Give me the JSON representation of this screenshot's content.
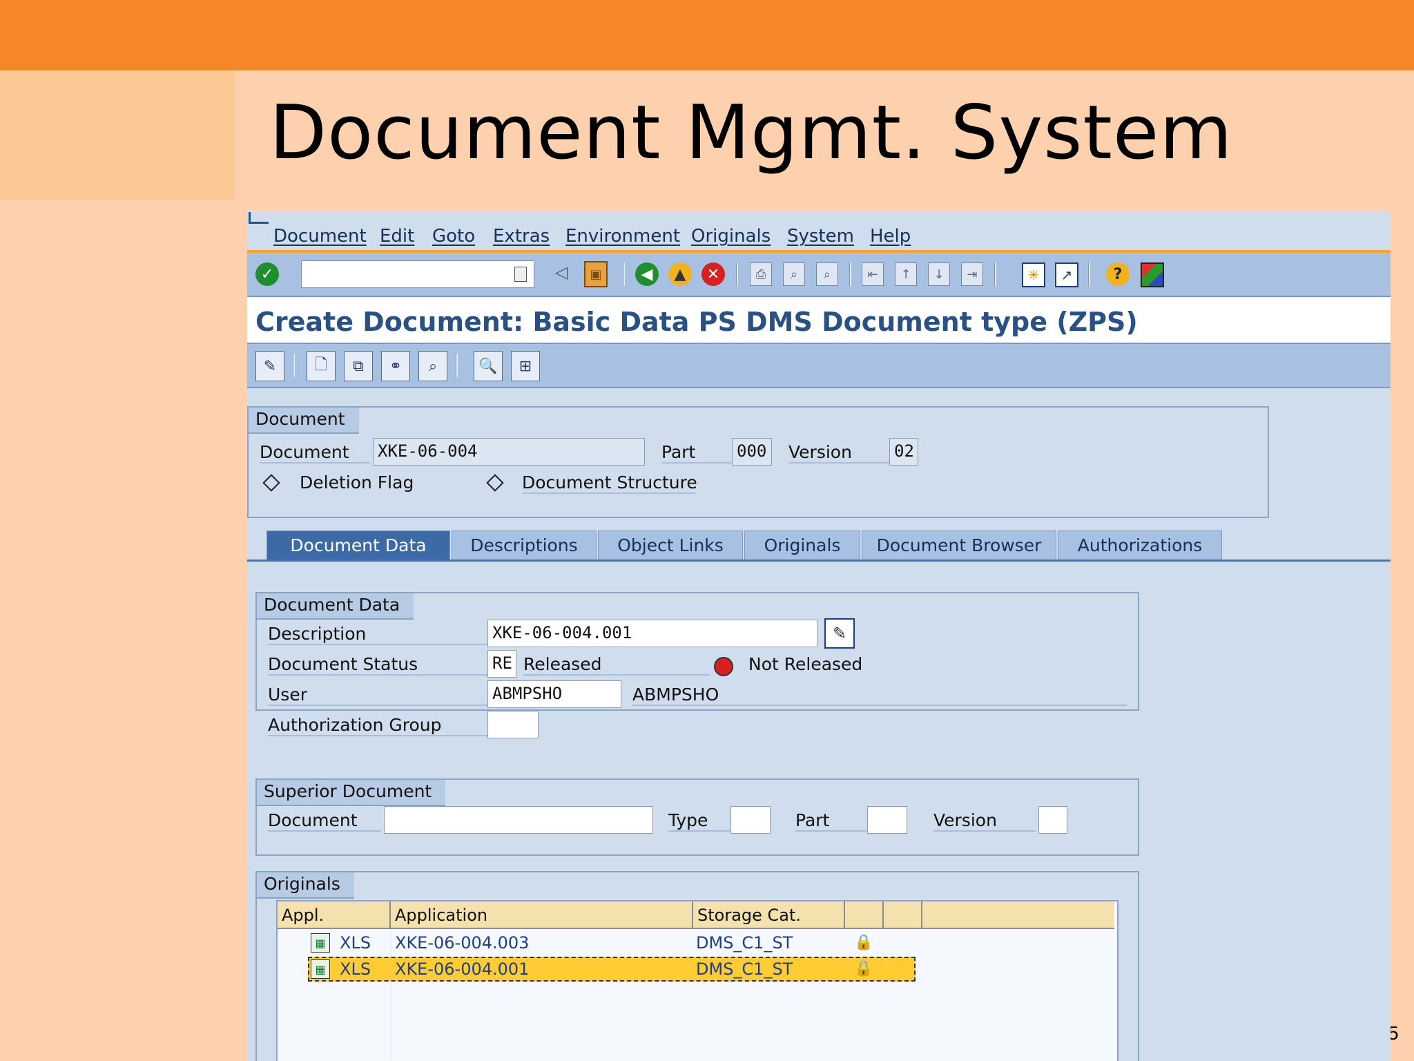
{
  "slide": {
    "title": "Document Mgmt. System",
    "page_number": "5"
  },
  "menu": [
    "Document",
    "Edit",
    "Goto",
    "Extras",
    "Environment",
    "Originals",
    "System",
    "Help"
  ],
  "screen_title": "Create Document: Basic Data PS DMS Document type (ZPS)",
  "header_group": {
    "title": "Document",
    "document_label": "Document",
    "document_value": "XKE-06-004",
    "part_label": "Part",
    "part_value": "000",
    "version_label": "Version",
    "version_value": "02",
    "deletion_flag": "Deletion Flag",
    "document_structure": "Document Structure"
  },
  "tabs": [
    "Document Data",
    "Descriptions",
    "Object Links",
    "Originals",
    "Document Browser",
    "Authorizations"
  ],
  "document_data": {
    "title": "Document Data",
    "description_label": "Description",
    "description_value": "XKE-06-004.001",
    "status_label": "Document Status",
    "status_code": "RE",
    "status_text": "Released",
    "not_released": "Not Released",
    "user_label": "User",
    "user_value": "ABMPSHO",
    "user_name": "ABMPSHO",
    "auth_label": "Authorization Group",
    "auth_value": ""
  },
  "superior": {
    "title": "Superior Document",
    "document_label": "Document",
    "type_label": "Type",
    "part_label": "Part",
    "version_label": "Version"
  },
  "originals": {
    "title": "Originals",
    "columns": [
      "Appl.",
      "Application",
      "Storage Cat.",
      "",
      ""
    ],
    "rows": [
      {
        "appl": "XLS",
        "application": "XKE-06-004.003",
        "storage": "DMS_C1_ST"
      },
      {
        "appl": "XLS",
        "application": "XKE-06-004.001",
        "storage": "DMS_C1_ST"
      }
    ]
  },
  "colors": {
    "accent_orange": "#f5862a",
    "sap_blue": "#2a5185",
    "selection": "#ffcc33"
  }
}
